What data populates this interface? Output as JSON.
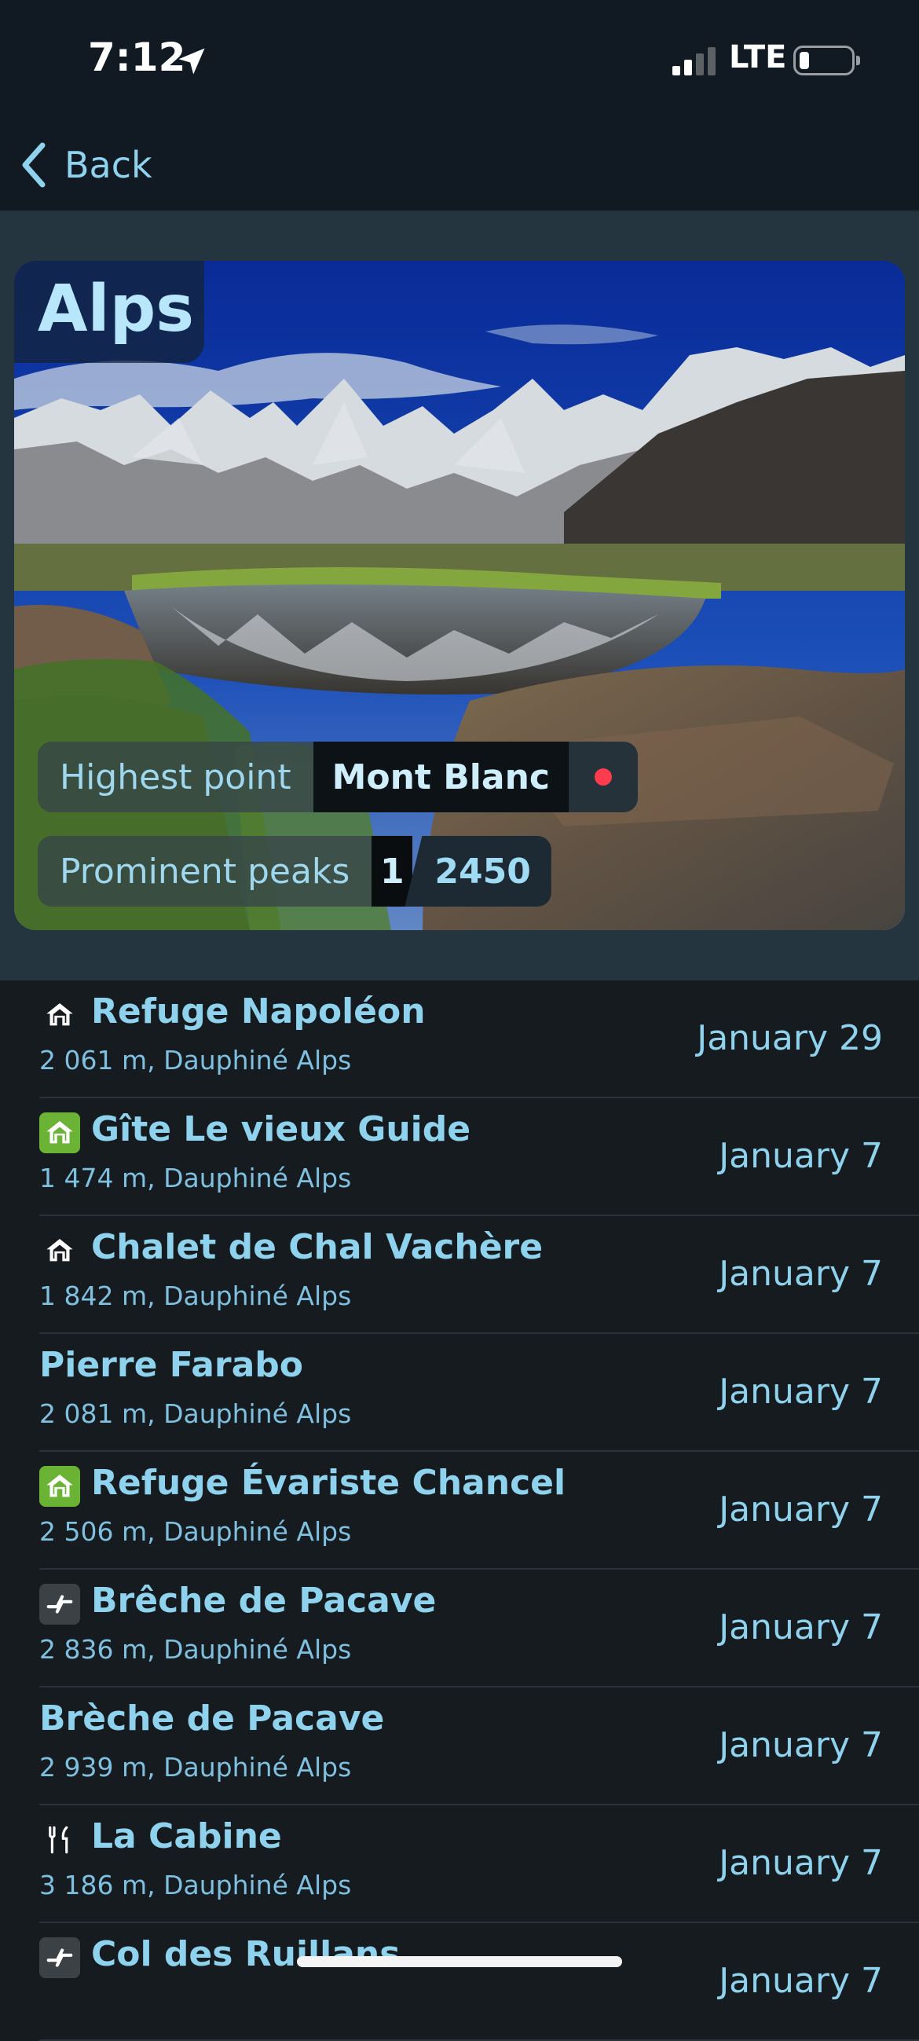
{
  "status_bar": {
    "time": "7:12",
    "network": "LTE"
  },
  "nav": {
    "back_label": "Back"
  },
  "region": {
    "title": "Alps",
    "highest_point_label": "Highest point",
    "highest_point_value": "Mont Blanc",
    "prominent_peaks_label": "Prominent peaks",
    "prominent_peaks_rank": "1",
    "prominent_peaks_total": "2450"
  },
  "huts": [
    {
      "name": "Refuge Napoléon",
      "details": "2 061 m, Dauphiné Alps",
      "date": "January 29",
      "icon": "house-icon",
      "icon_style": "plain"
    },
    {
      "name": "Gîte Le vieux Guide",
      "details": "1 474 m, Dauphiné Alps",
      "date": "January 7",
      "icon": "house-icon",
      "icon_style": "green"
    },
    {
      "name": "Chalet de Chal Vachère",
      "details": "1 842 m, Dauphiné Alps",
      "date": "January 7",
      "icon": "house-icon",
      "icon_style": "plain"
    },
    {
      "name": "Pierre Farabo",
      "details": "2 081 m, Dauphiné Alps",
      "date": "January 7",
      "icon": "",
      "icon_style": "none"
    },
    {
      "name": "Refuge Évariste Chancel",
      "details": "2 506 m, Dauphiné Alps",
      "date": "January 7",
      "icon": "house-icon",
      "icon_style": "green"
    },
    {
      "name": "Brêche de Pacave",
      "details": "2 836 m, Dauphiné Alps",
      "date": "January 7",
      "icon": "pass-icon",
      "icon_style": "gray"
    },
    {
      "name": "Brèche de Pacave",
      "details": "2 939 m, Dauphiné Alps",
      "date": "January 7",
      "icon": "",
      "icon_style": "none"
    },
    {
      "name": "La Cabine",
      "details": "3 186 m, Dauphiné Alps",
      "date": "January 7",
      "icon": "fork-knife-icon",
      "icon_style": "plain"
    },
    {
      "name": "Col des Ruillans",
      "details": "",
      "date": "January 7",
      "icon": "pass-icon",
      "icon_style": "gray"
    }
  ]
}
